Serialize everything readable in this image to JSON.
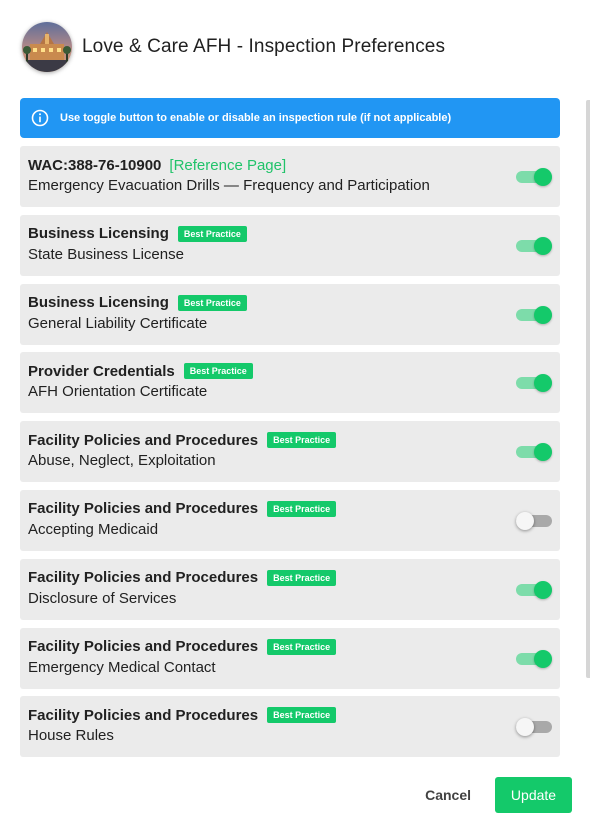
{
  "header": {
    "title": "Love & Care AFH - Inspection Preferences",
    "avatar_icon": "facility-photo"
  },
  "info": {
    "icon": "info-icon",
    "message": "Use toggle button to enable or disable an inspection rule (if not applicable)",
    "color": "#2196f3"
  },
  "rules": [
    {
      "category": "WAC:388-76-10900",
      "reference": "[Reference Page]",
      "badge": "",
      "description": "Emergency Evacuation Drills — Frequency and Participation",
      "enabled": true
    },
    {
      "category": "Business Licensing",
      "reference": "",
      "badge": "Best Practice",
      "description": "State Business License",
      "enabled": true
    },
    {
      "category": "Business Licensing",
      "reference": "",
      "badge": "Best Practice",
      "description": "General Liability Certificate",
      "enabled": true
    },
    {
      "category": "Provider Credentials",
      "reference": "",
      "badge": "Best Practice",
      "description": "AFH Orientation Certificate",
      "enabled": true
    },
    {
      "category": "Facility Policies and Procedures",
      "reference": "",
      "badge": "Best Practice",
      "description": "Abuse, Neglect, Exploitation",
      "enabled": true
    },
    {
      "category": "Facility Policies and Procedures",
      "reference": "",
      "badge": "Best Practice",
      "description": "Accepting Medicaid",
      "enabled": false
    },
    {
      "category": "Facility Policies and Procedures",
      "reference": "",
      "badge": "Best Practice",
      "description": "Disclosure of Services",
      "enabled": true
    },
    {
      "category": "Facility Policies and Procedures",
      "reference": "",
      "badge": "Best Practice",
      "description": "Emergency Medical Contact",
      "enabled": true
    },
    {
      "category": "Facility Policies and Procedures",
      "reference": "",
      "badge": "Best Practice",
      "description": "House Rules",
      "enabled": false
    }
  ],
  "footer": {
    "cancel_label": "Cancel",
    "update_label": "Update"
  },
  "colors": {
    "accent_green": "#14c96a",
    "info_blue": "#2196f3",
    "row_bg": "#ebebeb"
  }
}
